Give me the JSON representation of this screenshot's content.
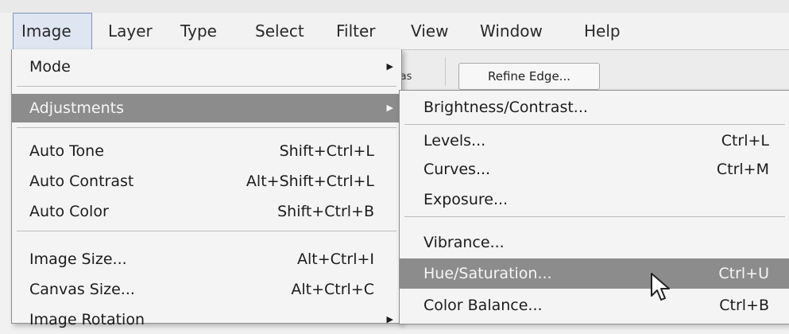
{
  "menubar": {
    "items": [
      {
        "label": "Image",
        "active": true
      },
      {
        "label": "Layer"
      },
      {
        "label": "Type"
      },
      {
        "label": "Select"
      },
      {
        "label": "Filter"
      },
      {
        "label": "View"
      },
      {
        "label": "Window"
      },
      {
        "label": "Help"
      }
    ]
  },
  "options_bar": {
    "partial_label": "ias",
    "refine_edge_label": "Refine Edge..."
  },
  "image_menu": {
    "items": [
      {
        "label": "Mode",
        "submenu": true
      },
      {
        "label": "Adjustments",
        "submenu": true,
        "highlighted": true
      },
      {
        "label": "Auto Tone",
        "shortcut": "Shift+Ctrl+L"
      },
      {
        "label": "Auto Contrast",
        "shortcut": "Alt+Shift+Ctrl+L"
      },
      {
        "label": "Auto Color",
        "shortcut": "Shift+Ctrl+B"
      },
      {
        "label": "Image Size...",
        "shortcut": "Alt+Ctrl+I"
      },
      {
        "label": "Canvas Size...",
        "shortcut": "Alt+Ctrl+C"
      },
      {
        "label": "Image Rotation",
        "submenu": true
      }
    ]
  },
  "adjustments_menu": {
    "items": [
      {
        "label": "Brightness/Contrast..."
      },
      {
        "label": "Levels...",
        "shortcut": "Ctrl+L"
      },
      {
        "label": "Curves...",
        "shortcut": "Ctrl+M"
      },
      {
        "label": "Exposure..."
      },
      {
        "label": "Vibrance..."
      },
      {
        "label": "Hue/Saturation...",
        "shortcut": "Ctrl+U",
        "highlighted": true
      },
      {
        "label": "Color Balance...",
        "shortcut": "Ctrl+B"
      }
    ]
  },
  "colors": {
    "highlight_bg": "#8c8c8c",
    "menu_bg": "#f4f4f4",
    "active_menu_bg": "#dfe6f2"
  }
}
